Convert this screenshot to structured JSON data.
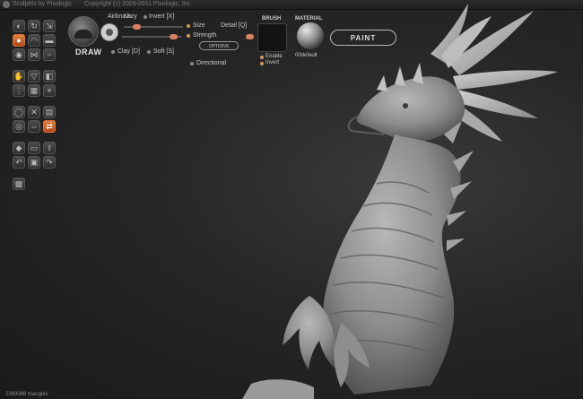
{
  "titlebar": {
    "app": "Sculptris by Pixologic",
    "copyright": "Copyright (c) 2009-2011 Pixologic, Inc."
  },
  "tools": {
    "rows": [
      [
        "brush-icon",
        "rotate-icon",
        "scale-icon"
      ],
      [
        "draw-icon",
        "crease-icon",
        "flatten-icon"
      ],
      [
        "inflate-icon",
        "pinch-icon",
        "smooth-icon"
      ],
      [
        "grab-icon",
        "reduce-icon",
        "mask-icon"
      ],
      [
        "symmetry-icon",
        "wireframe-icon",
        "camera-icon"
      ],
      [
        "sphere-icon",
        "cross-icon",
        "grid-icon"
      ],
      [
        "target-icon",
        "double-arrow-icon",
        "exchange-icon"
      ],
      [
        "paint-icon",
        "layer-icon",
        "export-icon"
      ],
      [
        "undo-icon",
        "lock-icon",
        "redo-icon"
      ],
      [
        "image-icon"
      ]
    ],
    "glyphs": [
      "◐",
      "↻",
      "⇲",
      "●",
      "◠",
      "▬",
      "◉",
      "⋈",
      "~",
      "✋",
      "▽",
      "◧",
      "⋮",
      "▦",
      "⌖",
      "◯",
      "✕",
      "▤",
      "◎",
      "⇔",
      "⇄",
      "◆",
      "▭",
      "⇪",
      "↶",
      "▣",
      "↷",
      "▩"
    ]
  },
  "brush": {
    "name": "DRAW",
    "airbrush": "Airbrush",
    "lazy": "Lazy",
    "invert": "Invert [X]",
    "size": "Size",
    "detail": "Detail [Q]",
    "strength": "Strength",
    "options": "OPTIONS",
    "clay": "Clay [D]",
    "soft": "Soft [S]",
    "directional": "Directional"
  },
  "brush_panel": {
    "header": "BRUSH",
    "enable": "Enable",
    "invert": "Invert"
  },
  "material_panel": {
    "header": "MATERIAL",
    "name": "00default"
  },
  "paint_button": "PAINT",
  "status": {
    "triangles": "2369086 triangles"
  },
  "colors": {
    "accent": "#e0733a",
    "slider_knob": "#d88060",
    "background": "#1e1e1e"
  }
}
